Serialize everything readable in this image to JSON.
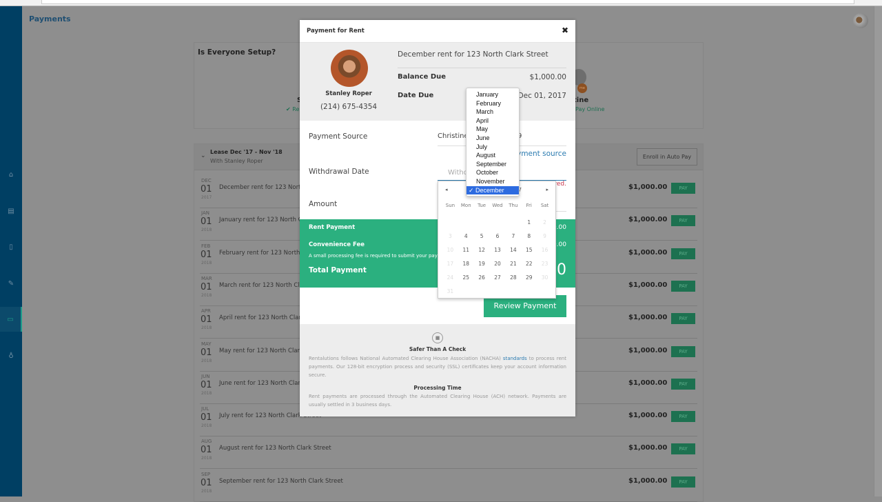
{
  "app": {
    "page_title": "Payments"
  },
  "sidebar": {
    "items": [
      {
        "name": "home",
        "icon": "home-icon",
        "glyph": "⌂"
      },
      {
        "name": "properties",
        "icon": "id-card-icon",
        "glyph": "▤"
      },
      {
        "name": "documents",
        "icon": "document-icon",
        "glyph": "▯"
      },
      {
        "name": "edit",
        "icon": "edit-icon",
        "glyph": "✎"
      },
      {
        "name": "payments",
        "icon": "payment-card-icon",
        "glyph": "▭",
        "active": true
      },
      {
        "name": "ideas",
        "icon": "lightbulb-icon",
        "glyph": "♁"
      }
    ]
  },
  "setup": {
    "title": "Is Everyone Setup?",
    "tenant1_initial": "S",
    "tenant1_status": "✔ Re",
    "tenant2_name_fragment": "tine",
    "tenant2_status": "Pay Online",
    "tenant2_badge": "me"
  },
  "lease": {
    "chevron": "⌄",
    "title": "Lease Dec '17 - Nov '18",
    "subtitle": "With Stanley Roper",
    "autopay_label": "Enroll in Auto Pay",
    "rows": [
      {
        "mon": "DEC",
        "day": "01",
        "yr": "2017",
        "desc": "December rent for 123 North Clark Street",
        "amt": "$1,000.00",
        "btn": "PAY"
      },
      {
        "mon": "JAN",
        "day": "01",
        "yr": "2018",
        "desc": "January rent for 123 North Clark Street",
        "amt": "$1,000.00",
        "btn": "PAY"
      },
      {
        "mon": "FEB",
        "day": "01",
        "yr": "2018",
        "desc": "February rent for 123 North Clark Street",
        "amt": "$1,000.00",
        "btn": "PAY"
      },
      {
        "mon": "MAR",
        "day": "01",
        "yr": "2018",
        "desc": "March rent for 123 North Clark Street",
        "amt": "$1,000.00",
        "btn": "PAY"
      },
      {
        "mon": "APR",
        "day": "01",
        "yr": "2018",
        "desc": "April rent for 123 North Clark Street",
        "amt": "$1,000.00",
        "btn": "PAY"
      },
      {
        "mon": "MAY",
        "day": "01",
        "yr": "2018",
        "desc": "May rent for 123 North Clark Street",
        "amt": "$1,000.00",
        "btn": "PAY"
      },
      {
        "mon": "JUN",
        "day": "01",
        "yr": "2018",
        "desc": "June rent for 123 North Clark Street",
        "amt": "$1,000.00",
        "btn": "PAY"
      },
      {
        "mon": "JUL",
        "day": "01",
        "yr": "2018",
        "desc": "July rent for 123 North Clark Street",
        "amt": "$1,000.00",
        "btn": "PAY"
      },
      {
        "mon": "AUG",
        "day": "01",
        "yr": "2018",
        "desc": "August rent for 123 North Clark Street",
        "amt": "$1,000.00",
        "btn": "PAY"
      },
      {
        "mon": "SEP",
        "day": "01",
        "yr": "2018",
        "desc": "September rent for 123 North Clark Street",
        "amt": "$1,000.00",
        "btn": "PAY"
      }
    ]
  },
  "modal": {
    "title": "Payment for Rent",
    "close": "✖",
    "landlord_name": "Stanley Roper",
    "landlord_phone": "(214) 675-4354",
    "description": "December rent for 123 North Clark Street",
    "balance_label": "Balance Due",
    "balance_value": "$1,000.00",
    "date_due_label": "Date Due",
    "date_due_value": "Dec 01, 2017",
    "payment_source_label": "Payment Source",
    "payment_source_value": "Christine ........ XXX6789",
    "add_source_link": "+ Add payment source",
    "withdrawal_label": "Withdrawal Date",
    "withdrawal_placeholder": "Withdrawal Date",
    "withdrawal_error": "Withdrawal date is required.",
    "amount_label": "Amount",
    "rent_payment_label": "Rent Payment",
    "rent_payment_value": "$1,000.00",
    "fee_label": "Convenience Fee",
    "fee_value": "$0.00",
    "fee_note": "A small processing fee is required to submit your payment online.",
    "total_label": "Total Payment",
    "total_value": "$1,000.00",
    "review_button": "Review Payment",
    "lock_glyph": "🔒",
    "safer_title": "Safer Than A Check",
    "safer_text_before": "Rentalutions follows National Automated Clearing House Association (NACHA) ",
    "safer_link": "standards",
    "safer_text_after": " to process rent payments. Our 128-bit encryption process and security (SSL) certificates keep your account information secure.",
    "processing_title": "Processing Time",
    "processing_text": "Rent payments are processed through the Automated Clearing House (ACH) network. Payments are usually settled in 3 business days."
  },
  "calendar": {
    "prev": "◂",
    "next": "▸",
    "year_trail": "7",
    "weekdays": [
      "Sun",
      "Mon",
      "Tue",
      "Wed",
      "Thu",
      "Fri",
      "Sat"
    ],
    "leading_blanks": 5,
    "days": [
      {
        "d": "1",
        "m": false
      },
      {
        "d": "2",
        "m": true
      },
      {
        "d": "3",
        "m": true
      },
      {
        "d": "4",
        "m": false
      },
      {
        "d": "5",
        "m": false
      },
      {
        "d": "6",
        "m": false
      },
      {
        "d": "7",
        "m": false
      },
      {
        "d": "8",
        "m": false
      },
      {
        "d": "9",
        "m": true
      },
      {
        "d": "10",
        "m": true
      },
      {
        "d": "11",
        "m": false
      },
      {
        "d": "12",
        "m": false
      },
      {
        "d": "13",
        "m": false
      },
      {
        "d": "14",
        "m": false
      },
      {
        "d": "15",
        "m": false
      },
      {
        "d": "16",
        "m": true
      },
      {
        "d": "17",
        "m": true
      },
      {
        "d": "18",
        "m": false
      },
      {
        "d": "19",
        "m": false
      },
      {
        "d": "20",
        "m": false
      },
      {
        "d": "21",
        "m": false
      },
      {
        "d": "22",
        "m": false
      },
      {
        "d": "23",
        "m": true
      },
      {
        "d": "24",
        "m": true
      },
      {
        "d": "25",
        "m": false
      },
      {
        "d": "26",
        "m": false
      },
      {
        "d": "27",
        "m": false
      },
      {
        "d": "28",
        "m": false
      },
      {
        "d": "29",
        "m": false
      },
      {
        "d": "30",
        "m": true
      },
      {
        "d": "31",
        "m": true
      }
    ]
  },
  "month_dropdown": {
    "options": [
      "January",
      "February",
      "March",
      "April",
      "May",
      "June",
      "July",
      "August",
      "September",
      "October",
      "November",
      "December"
    ],
    "selected": "December",
    "check": "✓ "
  }
}
